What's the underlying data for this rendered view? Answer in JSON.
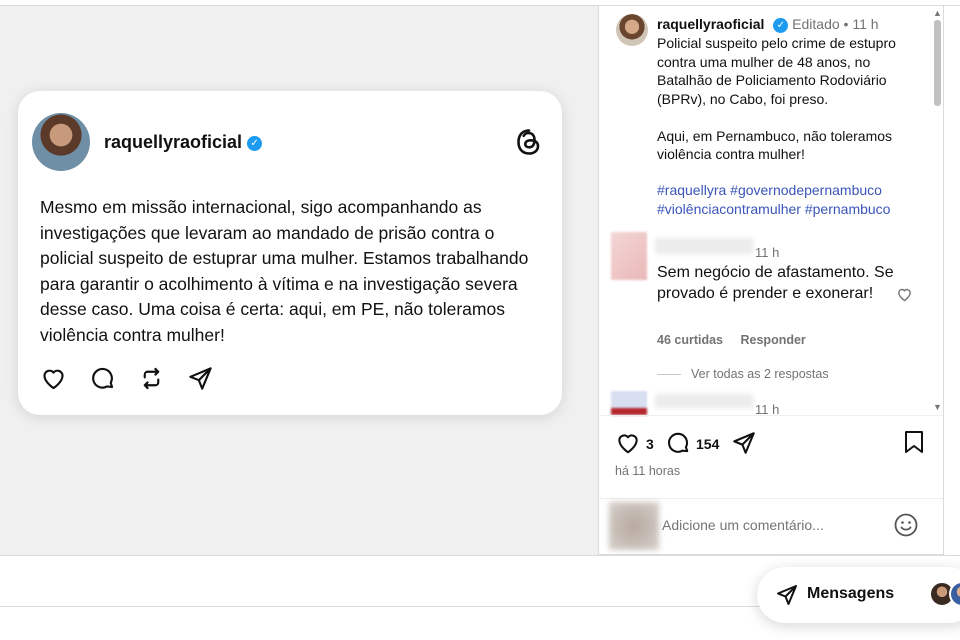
{
  "card": {
    "username": "raquellyraoficial",
    "text": "Mesmo em missão internacional, sigo acompanhando as investigações que levaram ao mandado de prisão contra o policial suspeito de estuprar uma mulher. Estamos trabalhando para garantir o acolhimento à vítima e na investigação severa desse caso. Uma coisa é certa: aqui, em PE, não toleramos violência contra mulher!",
    "actions": [
      "heart-icon",
      "comment-icon",
      "repost-icon",
      "share-icon"
    ]
  },
  "post": {
    "username": "raquellyraoficial",
    "edited": "Editado",
    "bullet": "•",
    "time": "11 h",
    "caption": "Policial suspeito pelo crime de estupro contra uma mulher de 48 anos, no Batalhão de Policiamento Rodoviário (BPRv), no Cabo, foi preso.\n\nAqui, em Pernambuco, não toleramos violência contra mulher!",
    "hashtags": "#raquellyra #governodepernambuco #violênciacontramulher #pernambuco"
  },
  "comments": [
    {
      "time": "11 h",
      "text": "Sem negócio de afastamento. Se provado é prender e exonerar!",
      "likes": "46 curtidas",
      "reply": "Responder",
      "view_replies": "Ver todas as 2 respostas"
    },
    {
      "time": "11 h"
    }
  ],
  "actions": {
    "likes_count": "3",
    "comments_count": "154",
    "posted_ago": "há 11 horas"
  },
  "add_comment": {
    "placeholder": "Adicione um comentário..."
  },
  "messages": {
    "label": "Mensagens"
  },
  "colors": {
    "verified": "#1d9bf0",
    "hashtag": "#3a56b8",
    "muted": "#737373"
  }
}
